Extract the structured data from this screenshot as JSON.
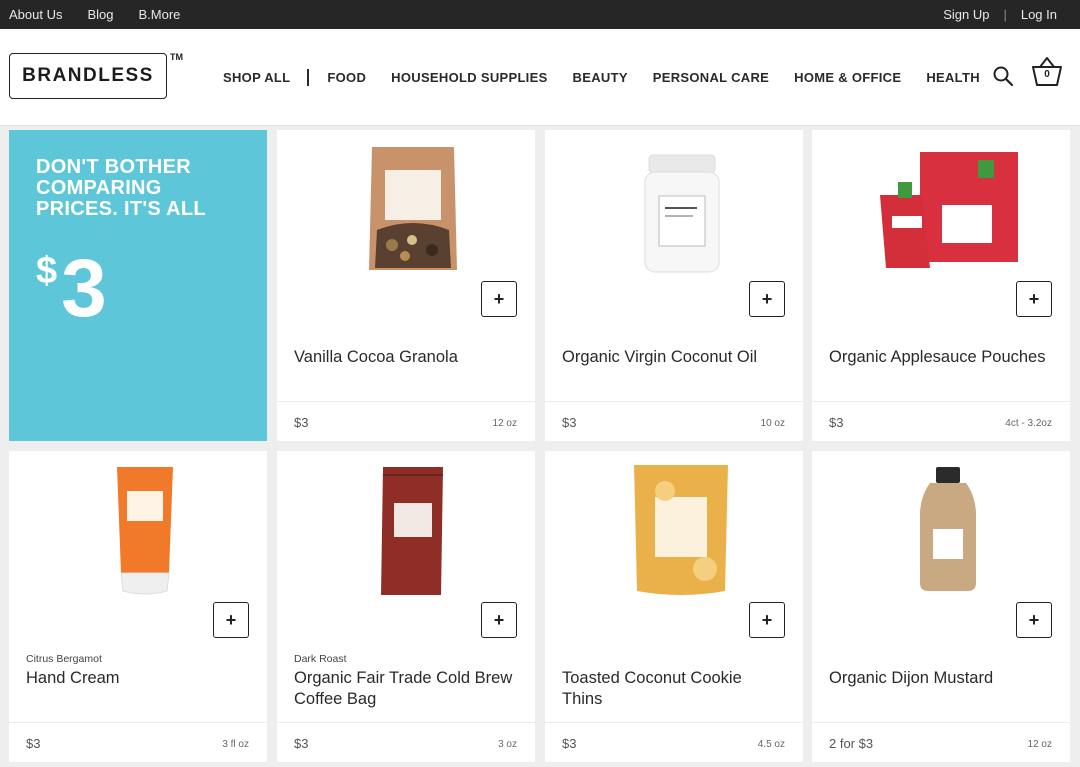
{
  "topbar": {
    "links": [
      "About Us",
      "Blog",
      "B.More"
    ],
    "signup": "Sign Up",
    "separator": "|",
    "login": "Log In"
  },
  "header": {
    "logo": "BRANDLESS",
    "trademark": "TM",
    "nav": [
      "SHOP ALL",
      "FOOD",
      "HOUSEHOLD SUPPLIES",
      "BEAUTY",
      "PERSONAL CARE",
      "HOME & OFFICE",
      "HEALTH"
    ],
    "cart_count": "0"
  },
  "promo": {
    "headline": "DON'T BOTHER COMPARING PRICES. IT'S ALL",
    "currency": "$",
    "amount": "3"
  },
  "add_label": "+",
  "products": [
    {
      "name": "Vanilla Cocoa Granola",
      "variant": "",
      "price": "$3",
      "size": "12 oz",
      "image": "granola-bag",
      "color": "#c8936b"
    },
    {
      "name": "Organic Virgin Coconut Oil",
      "variant": "",
      "price": "$3",
      "size": "10 oz",
      "image": "coconut-oil-jar",
      "color": "#f5f5f5"
    },
    {
      "name": "Organic Applesauce Pouches",
      "variant": "",
      "price": "$3",
      "size": "4ct - 3.2oz",
      "image": "applesauce-box",
      "color": "#d9303f"
    },
    {
      "name": "Hand Cream",
      "variant": "Citrus Bergamot",
      "price": "$3",
      "size": "3 fl oz",
      "image": "hand-cream-tube",
      "color": "#f07a2a"
    },
    {
      "name": "Organic Fair Trade Cold Brew Coffee Bag",
      "variant": "Dark Roast",
      "price": "$3",
      "size": "3 oz",
      "image": "coffee-bag",
      "color": "#8f2d27"
    },
    {
      "name": "Toasted Coconut Cookie Thins",
      "variant": "",
      "price": "$3",
      "size": "4.5 oz",
      "image": "cookie-bag",
      "color": "#eab14a"
    },
    {
      "name": "Organic Dijon Mustard",
      "variant": "",
      "price": "2 for $3",
      "size": "12 oz",
      "image": "mustard-bottle",
      "color": "#c9a982"
    }
  ]
}
